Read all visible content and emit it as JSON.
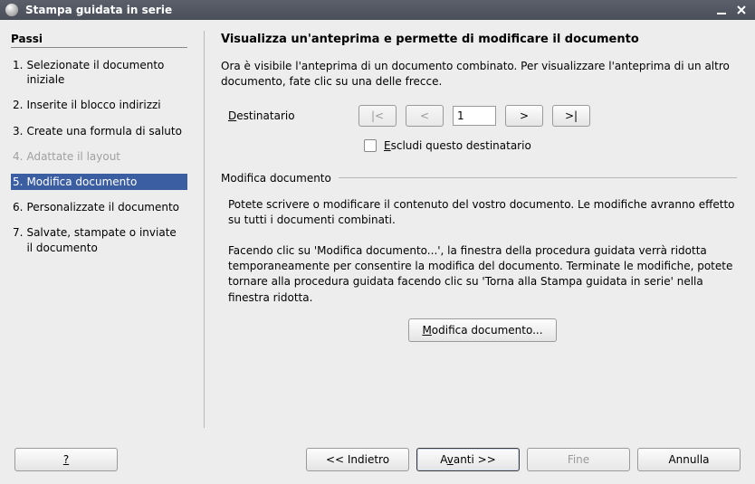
{
  "title": "Stampa guidata in serie",
  "steps_header": "Passi",
  "steps": [
    {
      "num": "1.",
      "label": "Selezionate il documento iniziale",
      "state": "normal"
    },
    {
      "num": "2.",
      "label": "Inserite il blocco indirizzi",
      "state": "normal"
    },
    {
      "num": "3.",
      "label": "Create una formula di saluto",
      "state": "normal"
    },
    {
      "num": "4.",
      "label": "Adattate il layout",
      "state": "disabled"
    },
    {
      "num": "5.",
      "label": "Modifica documento",
      "state": "current"
    },
    {
      "num": "6.",
      "label": "Personalizzate il documento",
      "state": "normal"
    },
    {
      "num": "7.",
      "label": "Salvate, stampate o inviate il documento",
      "state": "normal"
    }
  ],
  "main": {
    "heading": "Visualizza un'anteprima e permette di modificare il documento",
    "intro": "Ora è visibile l'anteprima di un documento combinato. Per visualizzare l'anteprima di un altro documento, fate clic su una delle frecce.",
    "recipient_ul": "D",
    "recipient_rest": "estinatario",
    "nav_first": "|<",
    "nav_prev": "<",
    "nav_value": "1",
    "nav_next": ">",
    "nav_last": ">|",
    "exclude_ul": "E",
    "exclude_rest": "scludi questo destinatario",
    "section_label": "Modifica documento",
    "edit_p1": "Potete scrivere o modificare il contenuto del vostro documento. Le modifiche avranno effetto su tutti i documenti combinati.",
    "edit_p2": "Facendo clic su 'Modifica documento...', la finestra della procedura guidata verrà ridotta temporaneamente per consentire la modifica del documento. Terminate le modifiche, potete tornare alla procedura guidata facendo clic su 'Torna alla Stampa guidata in serie' nella finestra ridotta.",
    "edit_btn_ul": "M",
    "edit_btn_rest": "odifica documento..."
  },
  "footer": {
    "help": "?",
    "back": "<< Indietro",
    "next_pre": "A",
    "next_ul": "v",
    "next_post": "anti >>",
    "finish": "Fine",
    "cancel": "Annulla"
  }
}
